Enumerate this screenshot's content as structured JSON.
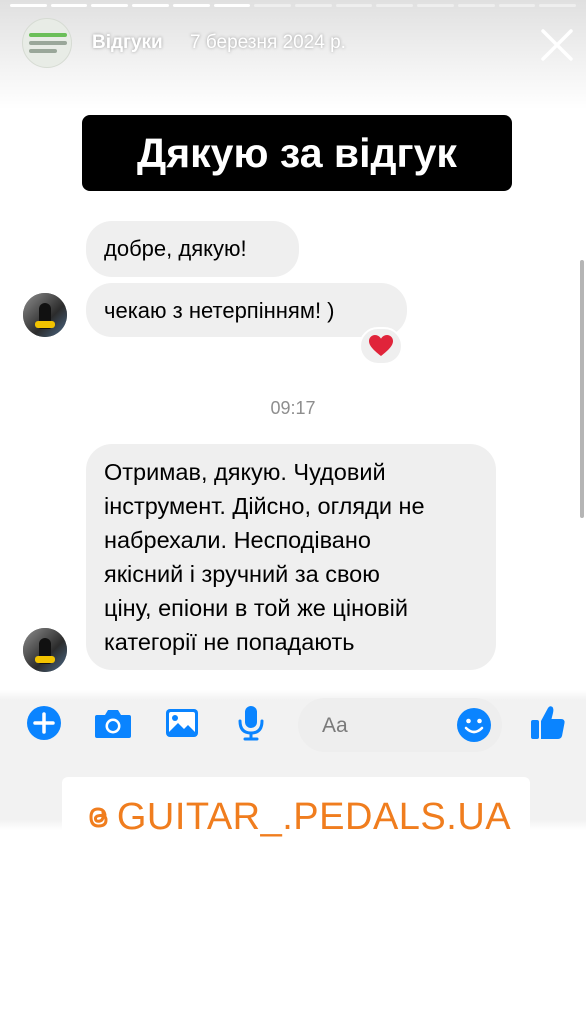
{
  "story": {
    "user": "Відгуки",
    "date": "7 березня 2024 р.",
    "progress": {
      "segments": 14,
      "completed": 6
    }
  },
  "header_avatar": {
    "label": "guitar_pedals"
  },
  "title": "Дякую за відгук",
  "messages": [
    {
      "text": "добре, дякую!"
    },
    {
      "text": "чекаю з нетерпінням! )",
      "reaction": "❤️"
    }
  ],
  "timestamp": "09:17",
  "long_message": {
    "lines": [
      "Отримав, дякую. Чудовий",
      "інструмент. Дійсно, огляди не",
      "набрехали. Несподівано",
      "якісний і зручний за свою",
      "ціну, епіони в той же ціновій",
      "категорії не попадають"
    ]
  },
  "composer": {
    "placeholder": "Aa",
    "icons": [
      "plus-icon",
      "camera-icon",
      "image-icon",
      "microphone-icon",
      "emoji-icon",
      "thumbs-up-icon"
    ]
  },
  "handle": "GUITAR_.PEDALS.UA",
  "colors": {
    "messenger_blue": "#0a84ff",
    "handle_orange": "#f07d1e",
    "bubble_gray": "#efefef",
    "heart_red": "#e0243a"
  }
}
